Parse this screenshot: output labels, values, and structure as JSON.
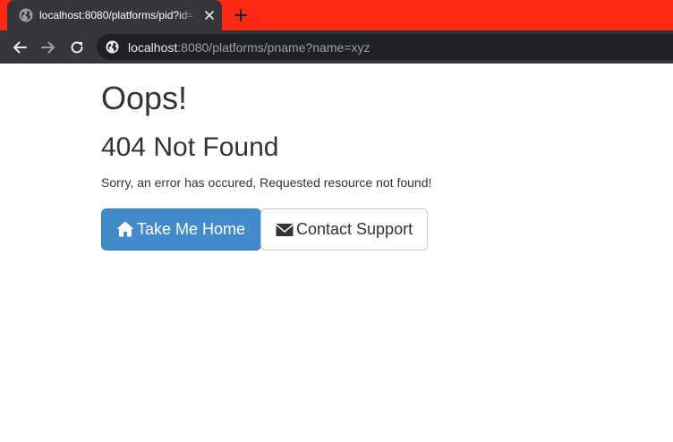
{
  "browser": {
    "tab": {
      "title": "localhost:8080/platforms/pid?id=",
      "favicon": "globe-icon",
      "close_icon": "close-icon"
    },
    "new_tab_icon": "plus-icon",
    "toolbar": {
      "back_icon": "arrow-left-icon",
      "forward_icon": "arrow-right-icon",
      "reload_icon": "reload-icon"
    },
    "address_bar": {
      "site_icon": "globe-icon",
      "url_host": "localhost",
      "url_rest": ":8080/platforms/pname?name=xyz"
    },
    "colors": {
      "tabstrip": "#ff2a15",
      "toolbar": "#35363a",
      "omnibox": "#202124"
    }
  },
  "page": {
    "heading": "Oops!",
    "subheading": "404 Not Found",
    "message": "Sorry, an error has occured, Requested resource not found!",
    "buttons": {
      "home": {
        "label": "Take Me Home",
        "icon": "home-icon"
      },
      "support": {
        "label": "Contact Support",
        "icon": "envelope-icon"
      }
    },
    "colors": {
      "primary": "#428bca",
      "text": "#333333"
    }
  }
}
